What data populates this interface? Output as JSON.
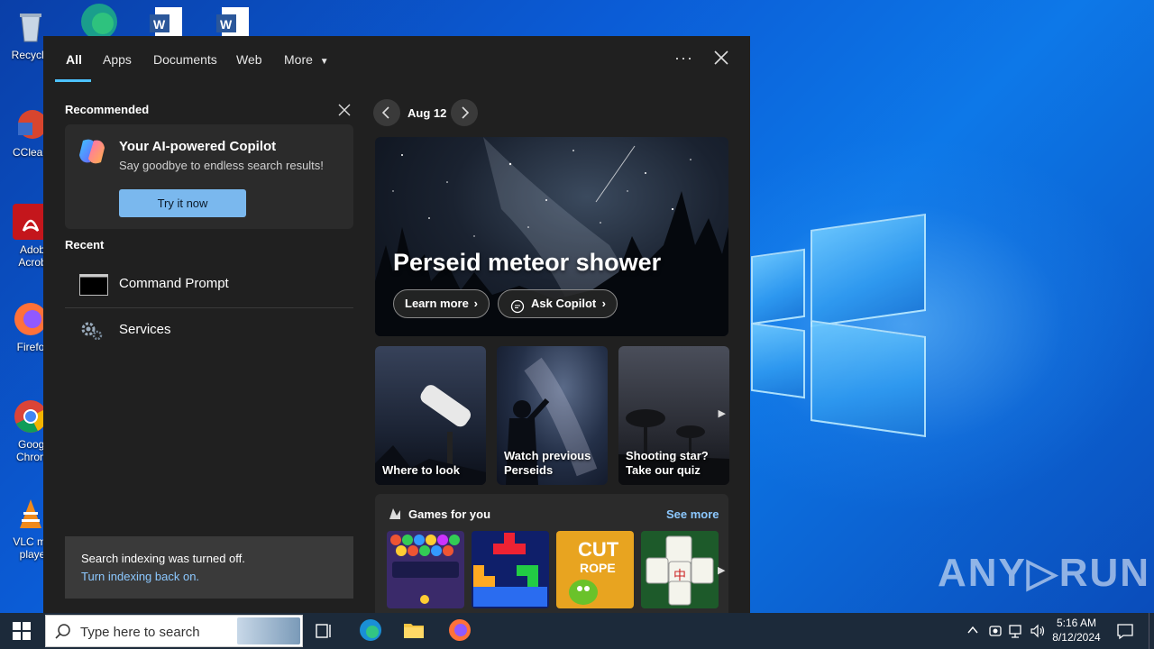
{
  "desktop": {
    "icons": [
      {
        "label": "Recycle",
        "name": "recycle-bin-icon"
      },
      {
        "label": "CClean",
        "name": "ccleaner-icon"
      },
      {
        "label": "Adob Acrob",
        "name": "adobe-acrobat-icon"
      },
      {
        "label": "Firefo",
        "name": "firefox-icon"
      },
      {
        "label": "Googl Chrom",
        "name": "chrome-icon"
      },
      {
        "label": "VLC me playe",
        "name": "vlc-icon"
      }
    ],
    "watermark": "ANY▷RUN"
  },
  "search": {
    "tabs": [
      "All",
      "Apps",
      "Documents",
      "Web",
      "More"
    ],
    "recommended_title": "Recommended",
    "copilot": {
      "title": "Your AI-powered Copilot",
      "subtitle": "Say goodbye to endless search results!",
      "button": "Try it now"
    },
    "recent_title": "Recent",
    "recent": [
      "Command Prompt",
      "Services"
    ],
    "indexing": {
      "text": "Search indexing was turned off.",
      "link": "Turn indexing back on."
    },
    "date": "Aug 12",
    "hero": {
      "title": "Perseid meteor shower",
      "learn_more": "Learn more",
      "ask_copilot": "Ask Copilot"
    },
    "tiles": [
      "Where to look",
      "Watch previous Perseids",
      "Shooting star? Take our quiz"
    ],
    "games": {
      "title": "Games for you",
      "see_more": "See more"
    }
  },
  "taskbar": {
    "search_placeholder": "Type here to search",
    "time": "5:16 AM",
    "date": "8/12/2024"
  },
  "colors": {
    "accent": "#4cc2ff",
    "panel_bg": "#202020",
    "card_bg": "#2b2b2b",
    "button": "#7ab8ee",
    "link": "#8cc8ff"
  }
}
